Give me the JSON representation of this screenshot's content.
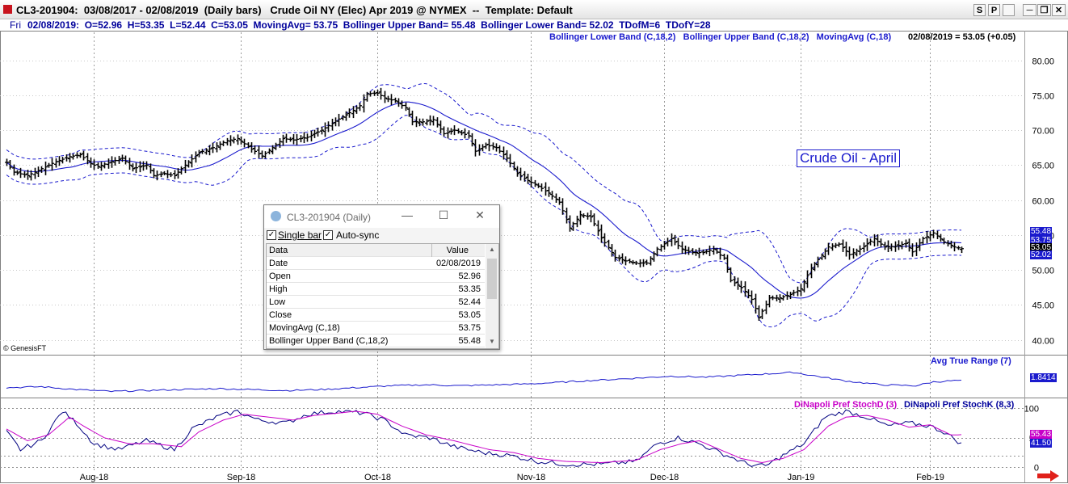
{
  "window": {
    "title": "CL3-201904:  03/08/2017 - 02/08/2019  (Daily bars)   Crude Oil NY (Elec) Apr 2019 @ NYMEX  --  Template: Default",
    "buttons": [
      "S",
      "P",
      "▬",
      "❐",
      "✕"
    ]
  },
  "infobar": {
    "day": "Fri",
    "values": "02/08/2019:  O=52.96  H=53.35  L=52.44  C=53.05  MovingAvg= 53.75  Bollinger Upper Band= 55.48  Bollinger Lower Band= 52.02  TDofM=6  TDofY=28"
  },
  "price_legend": {
    "items": "Bollinger Lower Band (C,18,2)   Bollinger Upper Band (C,18,2)   MovingAvg (C,18)",
    "last": "02/08/2019 = 53.05 (+0.05)"
  },
  "annotation": "Crude Oil - April",
  "copyright": "© GenesisFT",
  "atr_legend": "Avg True Range (7)",
  "stoch_legend": {
    "d": "DiNapoli Pref StochD (3)",
    "k": "DiNapoli Pref StochK (8,3)"
  },
  "dialog": {
    "title": "CL3-201904 (Daily)",
    "single_bar": "Single bar",
    "auto_sync": "Auto-sync",
    "col_data": "Data",
    "col_value": "Value",
    "rows": [
      {
        "k": "Date",
        "v": "02/08/2019"
      },
      {
        "k": "Open",
        "v": "52.96"
      },
      {
        "k": "High",
        "v": "53.35"
      },
      {
        "k": "Low",
        "v": "52.44"
      },
      {
        "k": "Close",
        "v": "53.05"
      },
      {
        "k": "MovingAvg (C,18)",
        "v": "53.75"
      },
      {
        "k": "Bollinger Upper Band (C,18,2)",
        "v": "55.48"
      }
    ]
  },
  "colors": {
    "bars": "#000000",
    "ma": "#1a1acd",
    "bands": "#1a1acd",
    "atr": "#1a1acd",
    "stoch_k": "#000080",
    "stoch_d": "#c800c8",
    "upper_tag": "#1a1acd",
    "close_tag": "#000000",
    "lower_tag": "#1a1acd",
    "atr_tag": "#1a1acd",
    "stochd_tag": "#c800c8",
    "stochk_tag": "#1a1acd"
  },
  "chart_data": [
    {
      "type": "ohlc",
      "title": "Crude Oil NY (Elec) Apr 2019",
      "ylim": [
        38,
        84
      ],
      "y_ticks": [
        "80.00",
        "75.00",
        "70.00",
        "65.00",
        "60.00",
        "55.00",
        "50.00",
        "45.00",
        "40.00"
      ],
      "y_tick_values": [
        80,
        75,
        70,
        65,
        60,
        55,
        50,
        45,
        40
      ],
      "x_ticks": [
        "Aug-18",
        "Sep-18",
        "Oct-18",
        "Nov-18",
        "Dec-18",
        "Jan-19",
        "Feb-19"
      ],
      "x_tick_index": [
        25,
        67,
        106,
        150,
        188,
        227,
        264
      ],
      "grid": true,
      "bar_count": 274,
      "close_key": [
        [
          0,
          65.4
        ],
        [
          2,
          64.0
        ],
        [
          6,
          63.5
        ],
        [
          10,
          64.5
        ],
        [
          14,
          65.5
        ],
        [
          18,
          66.2
        ],
        [
          21,
          66.5
        ],
        [
          24,
          65.2
        ],
        [
          26,
          64.8
        ],
        [
          30,
          65.5
        ],
        [
          33,
          66.0
        ],
        [
          36,
          64.5
        ],
        [
          40,
          65.0
        ],
        [
          42,
          63.5
        ],
        [
          45,
          63.8
        ],
        [
          48,
          63.5
        ],
        [
          51,
          65.0
        ],
        [
          55,
          66.8
        ],
        [
          59,
          67.5
        ],
        [
          63,
          68.5
        ],
        [
          66,
          68.8
        ],
        [
          70,
          67.3
        ],
        [
          73,
          66.3
        ],
        [
          76,
          67.5
        ],
        [
          79,
          68.8
        ],
        [
          82,
          68.6
        ],
        [
          86,
          69.0
        ],
        [
          90,
          70.0
        ],
        [
          94,
          71.3
        ],
        [
          98,
          72.5
        ],
        [
          101,
          73.5
        ],
        [
          103,
          75.2
        ],
        [
          106,
          75.3
        ],
        [
          108,
          74.6
        ],
        [
          111,
          74.2
        ],
        [
          114,
          73.2
        ],
        [
          116,
          71.2
        ],
        [
          119,
          71.2
        ],
        [
          122,
          71.5
        ],
        [
          125,
          69.5
        ],
        [
          128,
          70.0
        ],
        [
          132,
          69.2
        ],
        [
          134,
          67.0
        ],
        [
          137,
          67.9
        ],
        [
          140,
          67.5
        ],
        [
          143,
          66.0
        ],
        [
          146,
          63.8
        ],
        [
          149,
          62.8
        ],
        [
          152,
          62.0
        ],
        [
          155,
          61.0
        ],
        [
          158,
          59.7
        ],
        [
          161,
          56.0
        ],
        [
          164,
          57.9
        ],
        [
          167,
          57.6
        ],
        [
          170,
          54.6
        ],
        [
          174,
          51.8
        ],
        [
          177,
          51.3
        ],
        [
          180,
          51.0
        ],
        [
          183,
          51.0
        ],
        [
          186,
          53.0
        ],
        [
          190,
          54.5
        ],
        [
          193,
          53.0
        ],
        [
          196,
          52.5
        ],
        [
          199,
          52.5
        ],
        [
          202,
          53.0
        ],
        [
          205,
          51.7
        ],
        [
          207,
          48.5
        ],
        [
          210,
          47.5
        ],
        [
          213,
          45.8
        ],
        [
          215,
          43.2
        ],
        [
          218,
          46.0
        ],
        [
          221,
          46.0
        ],
        [
          224,
          46.5
        ],
        [
          227,
          47.3
        ],
        [
          230,
          50.3
        ],
        [
          232,
          51.5
        ],
        [
          235,
          53.3
        ],
        [
          238,
          53.7
        ],
        [
          241,
          52.2
        ],
        [
          244,
          53.0
        ],
        [
          248,
          54.5
        ],
        [
          251,
          53.3
        ],
        [
          254,
          53.4
        ],
        [
          257,
          53.8
        ],
        [
          259,
          52.6
        ],
        [
          262,
          54.5
        ],
        [
          265,
          55.3
        ],
        [
          268,
          54.0
        ],
        [
          271,
          53.3
        ],
        [
          273,
          53.05
        ]
      ],
      "last": {
        "date": "02/08/2019",
        "open": 52.96,
        "high": 53.35,
        "low": 52.44,
        "close": 53.05
      },
      "series": [
        {
          "name": "MovingAvg (C,18)",
          "last": 53.75
        },
        {
          "name": "Bollinger Upper Band (C,18,2)",
          "last": 55.48
        },
        {
          "name": "Bollinger Lower Band (C,18,2)",
          "last": 52.02
        }
      ],
      "right_labels": [
        "55.48",
        "53.75",
        "53.05",
        "52.02"
      ]
    },
    {
      "type": "line",
      "series_name": "Avg True Range (7)",
      "last": 1.8414,
      "right_label": "1.8414",
      "key": [
        [
          0,
          1.45
        ],
        [
          10,
          1.5
        ],
        [
          20,
          1.35
        ],
        [
          30,
          1.25
        ],
        [
          40,
          1.3
        ],
        [
          50,
          1.35
        ],
        [
          60,
          1.4
        ],
        [
          70,
          1.35
        ],
        [
          80,
          1.3
        ],
        [
          90,
          1.35
        ],
        [
          100,
          1.45
        ],
        [
          110,
          1.55
        ],
        [
          120,
          1.6
        ],
        [
          130,
          1.55
        ],
        [
          140,
          1.6
        ],
        [
          150,
          1.65
        ],
        [
          160,
          1.75
        ],
        [
          170,
          1.85
        ],
        [
          180,
          1.95
        ],
        [
          190,
          2.05
        ],
        [
          200,
          2.0
        ],
        [
          210,
          2.1
        ],
        [
          220,
          2.2
        ],
        [
          225,
          2.25
        ],
        [
          230,
          2.1
        ],
        [
          240,
          1.8
        ],
        [
          250,
          1.6
        ],
        [
          260,
          1.55
        ],
        [
          265,
          1.75
        ],
        [
          273,
          1.84
        ]
      ]
    },
    {
      "type": "line",
      "ylim": [
        -5,
        110
      ],
      "y_ticks": [
        "100",
        "50",
        "0"
      ],
      "y_tick_values": [
        100,
        50,
        0
      ],
      "series": [
        {
          "name": "DiNapoli Pref StochD (3)",
          "last": 55.43,
          "key": [
            [
              0,
              65
            ],
            [
              6,
              45
            ],
            [
              12,
              55
            ],
            [
              18,
              85
            ],
            [
              22,
              70
            ],
            [
              28,
              50
            ],
            [
              35,
              40
            ],
            [
              42,
              40
            ],
            [
              50,
              35
            ],
            [
              55,
              60
            ],
            [
              62,
              80
            ],
            [
              68,
              90
            ],
            [
              75,
              85
            ],
            [
              82,
              80
            ],
            [
              88,
              88
            ],
            [
              95,
              92
            ],
            [
              100,
              95
            ],
            [
              106,
              90
            ],
            [
              113,
              70
            ],
            [
              120,
              55
            ],
            [
              128,
              45
            ],
            [
              138,
              30
            ],
            [
              145,
              25
            ],
            [
              152,
              15
            ],
            [
              160,
              10
            ],
            [
              170,
              8
            ],
            [
              180,
              12
            ],
            [
              187,
              30
            ],
            [
              193,
              40
            ],
            [
              198,
              45
            ],
            [
              204,
              30
            ],
            [
              210,
              15
            ],
            [
              216,
              8
            ],
            [
              222,
              15
            ],
            [
              228,
              30
            ],
            [
              235,
              70
            ],
            [
              240,
              85
            ],
            [
              246,
              88
            ],
            [
              252,
              80
            ],
            [
              258,
              68
            ],
            [
              264,
              72
            ],
            [
              270,
              55
            ],
            [
              273,
              55
            ]
          ]
        },
        {
          "name": "DiNapoli Pref StochK (8,3)",
          "last": 41.5,
          "key": [
            [
              0,
              60
            ],
            [
              4,
              30
            ],
            [
              10,
              45
            ],
            [
              16,
              95
            ],
            [
              20,
              75
            ],
            [
              25,
              40
            ],
            [
              32,
              30
            ],
            [
              40,
              45
            ],
            [
              48,
              30
            ],
            [
              53,
              65
            ],
            [
              60,
              85
            ],
            [
              66,
              95
            ],
            [
              72,
              80
            ],
            [
              80,
              75
            ],
            [
              86,
              90
            ],
            [
              94,
              95
            ],
            [
              102,
              92
            ],
            [
              108,
              80
            ],
            [
              114,
              55
            ],
            [
              121,
              50
            ],
            [
              128,
              35
            ],
            [
              136,
              25
            ],
            [
              144,
              20
            ],
            [
              152,
              10
            ],
            [
              160,
              5
            ],
            [
              170,
              5
            ],
            [
              180,
              10
            ],
            [
              186,
              40
            ],
            [
              192,
              50
            ],
            [
              198,
              40
            ],
            [
              206,
              20
            ],
            [
              212,
              5
            ],
            [
              217,
              2
            ],
            [
              222,
              20
            ],
            [
              228,
              40
            ],
            [
              234,
              85
            ],
            [
              240,
              95
            ],
            [
              246,
              85
            ],
            [
              252,
              70
            ],
            [
              258,
              75
            ],
            [
              264,
              70
            ],
            [
              268,
              60
            ],
            [
              273,
              40
            ]
          ]
        }
      ],
      "right_labels": [
        "55.43",
        "41.50"
      ]
    }
  ]
}
